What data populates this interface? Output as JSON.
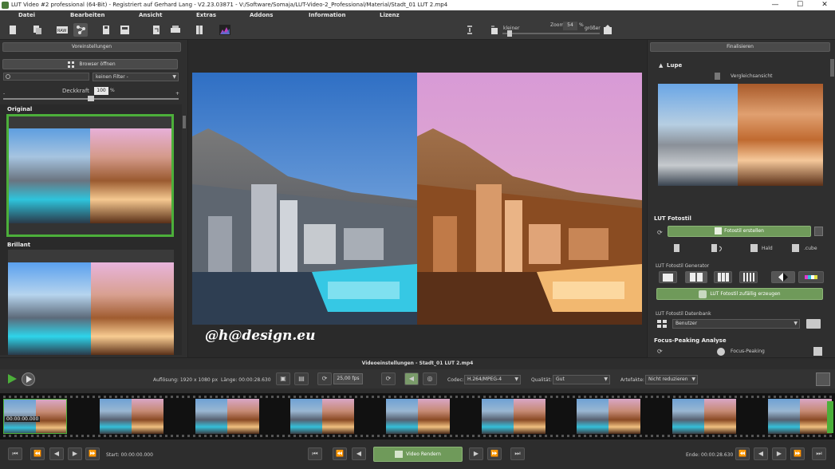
{
  "window": {
    "title": "LUT Video #2 professional (64-Bit) - Registriert auf Gerhard Lang - V2.23.03871 - V:/Software/Somaja/LUT-Video-2_Professional/Material/Stadt_01 LUT 2.mp4",
    "minimize": "—",
    "maximize": "☐",
    "close": "✕"
  },
  "menu": [
    "Datei",
    "Bearbeiten",
    "Ansicht",
    "Extras",
    "Addons",
    "Information",
    "Lizenz"
  ],
  "zoom": {
    "kleiner": "kleiner",
    "label": "Zoom",
    "value": "54",
    "unit": "%",
    "groesser": "größer"
  },
  "left": {
    "header": "Voreinstellungen",
    "browser": "Browser öffnen",
    "filter": "keinen Filter -",
    "deckkraft_label": "Deckkraft",
    "deckkraft_value": "100",
    "deckkraft_unit": "%",
    "minus": "-",
    "plus": "+",
    "presets": [
      "Original",
      "Brillant"
    ]
  },
  "watermark": "@h@design.eu",
  "right": {
    "header": "Finalisieren",
    "lupe": "Lupe",
    "vergleich": "Vergleichsansicht",
    "lut_fotostil": "LUT Fotostil",
    "fotostil_erstellen": "Fotostil erstellen",
    "hald": "Hald",
    "cube": ".cube",
    "generator": "LUT Fotostil Generator",
    "zufaellig": "LUT Fotostil zufällig erzeugen",
    "datenbank": "LUT Fotostil Datenbank",
    "benutzer": "Benutzer",
    "focus_analyse": "Focus-Peaking Analyse",
    "focus_peaking": "Focus-Peaking"
  },
  "video": {
    "header": "Videoeinstellungen - Stadt_01 LUT 2.mp4",
    "aufloesung": "Auflösung: 1920 x 1080 px",
    "laenge": "Länge: 00:00:28.630",
    "fps": "25,00 fps",
    "codec_label": "Codec:",
    "codec_value": "H.264/MPEG-4",
    "qualitaet_label": "Qualität:",
    "qualitaet_value": "Gut",
    "artefakte_label": "Artefakte:",
    "artefakte_value": "Nicht reduzieren",
    "timecode": "00:00:00.000",
    "start": "Start: 00:00:00.000",
    "ende": "Ende: 00:00:28.630",
    "render": "Video Rendern"
  },
  "colors": {
    "accent_green": "#6f9a5a",
    "thumb_border": "#4caf3a"
  }
}
